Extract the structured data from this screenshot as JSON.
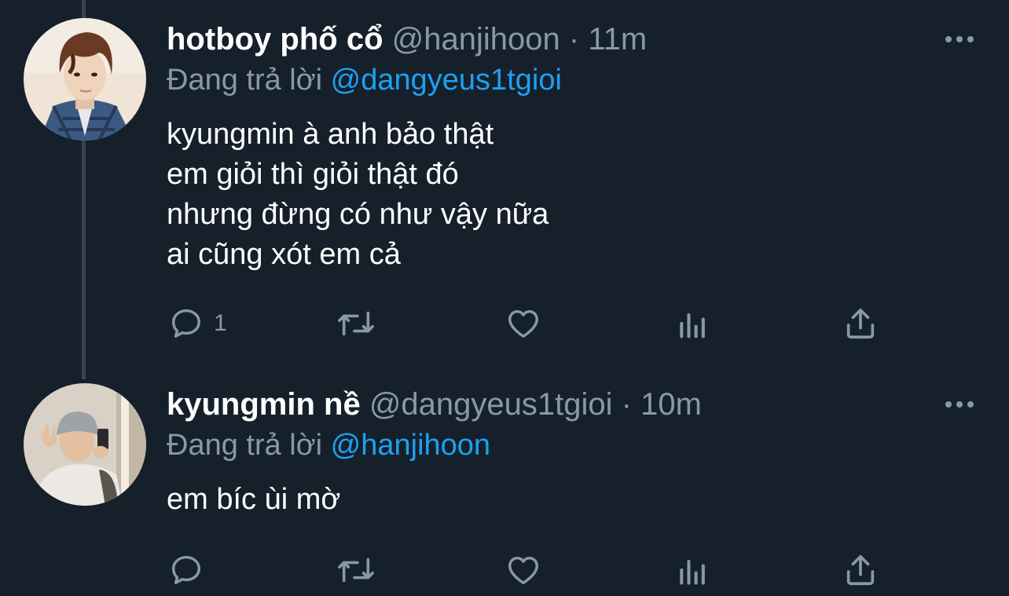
{
  "tweets": [
    {
      "display_name": "hotboy phố cổ",
      "handle": "@hanjihoon",
      "separator": "·",
      "time": "11m",
      "replying_prefix": "Đang trả lời",
      "replying_to": "@dangyeus1tgioi",
      "lines": [
        "kyungmin à anh bảo thật",
        "em giỏi thì giỏi thật đó",
        "nhưng đừng có như vậy nữa",
        "ai cũng xót em cả"
      ],
      "reply_count": "1",
      "avatar": "avatar-photo"
    },
    {
      "display_name": "kyungmin nề",
      "handle": "@dangyeus1tgioi",
      "separator": "·",
      "time": "10m",
      "replying_prefix": "Đang trả lời",
      "replying_to": "@hanjihoon",
      "lines": [
        "em bíc ùi mờ"
      ],
      "reply_count": "",
      "avatar": "avatar-photo"
    }
  ],
  "icons": {
    "reply": "reply-icon",
    "retweet": "retweet-icon",
    "like": "heart-icon",
    "analytics": "analytics-icon",
    "share": "share-icon",
    "more": "more-icon"
  },
  "colors": {
    "background": "#15202b",
    "thread_line": "#38444d",
    "secondary_text": "#8899a6",
    "mention": "#1da1f2",
    "primary_text": "#ffffff"
  }
}
